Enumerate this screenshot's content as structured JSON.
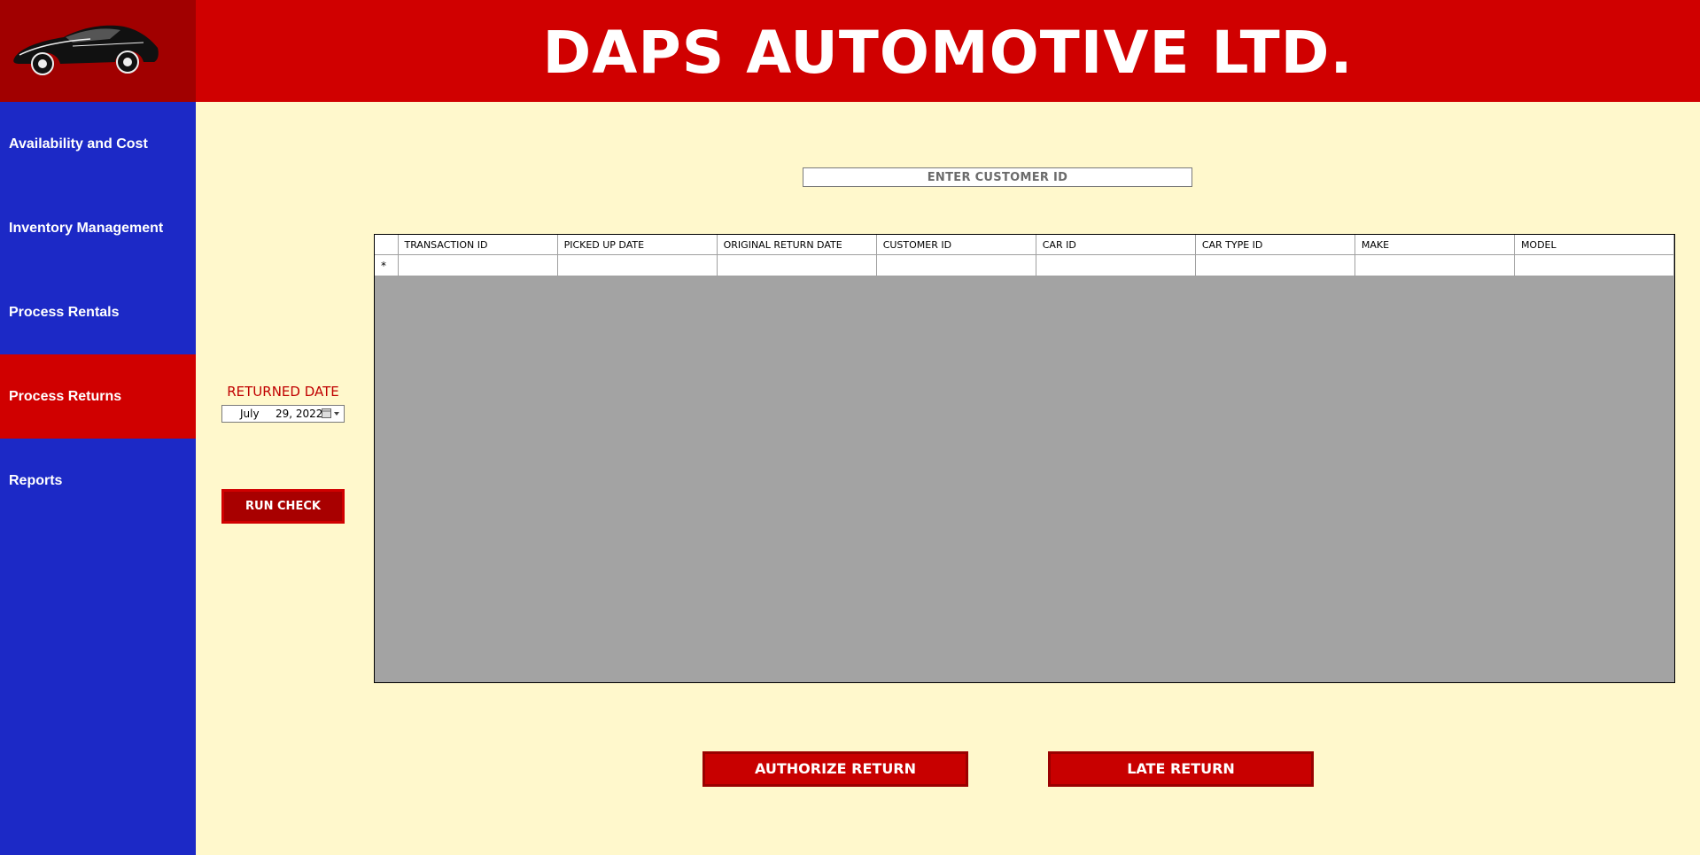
{
  "header": {
    "title": "DAPS AUTOMOTIVE LTD.",
    "logo_icon": "sports-car-icon"
  },
  "sidebar": {
    "items": [
      {
        "label": "Availability and Cost",
        "active": false
      },
      {
        "label": "Inventory Management",
        "active": false
      },
      {
        "label": "Process Rentals",
        "active": false
      },
      {
        "label": "Process Returns",
        "active": true
      },
      {
        "label": "Reports",
        "active": false
      }
    ]
  },
  "search": {
    "placeholder": "ENTER CUSTOMER ID"
  },
  "returned_date": {
    "label": "RETURNED DATE",
    "month": "July",
    "day_year": "29, 2022"
  },
  "buttons": {
    "run_check": "RUN CHECK",
    "authorize_return": "AUTHORIZE RETURN",
    "late_return": "LATE RETURN"
  },
  "table": {
    "columns": [
      "TRANSACTION ID",
      "PICKED UP DATE",
      "ORIGINAL RETURN DATE",
      "CUSTOMER ID",
      "CAR ID",
      "CAR TYPE ID",
      "MAKE",
      "MODEL"
    ],
    "new_row_marker": "*"
  },
  "colors": {
    "header_red": "#d00000",
    "logo_bg": "#a10000",
    "sidebar_blue": "#1c29c6",
    "content_bg": "#fff8cc",
    "grid_empty": "#a3a3a3"
  }
}
